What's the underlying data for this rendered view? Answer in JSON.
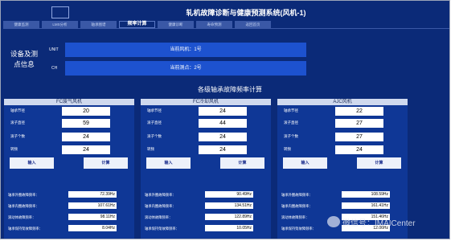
{
  "header": {
    "title": "轧机故障诊断与健康预测系统(风机-1)"
  },
  "tabs": [
    {
      "label": "健康监测"
    },
    {
      "label": "LMS分析"
    },
    {
      "label": "轴承图谱"
    },
    {
      "label": "频率计算"
    },
    {
      "label": "健康诊断"
    },
    {
      "label": "寿命预测"
    },
    {
      "label": "返回首页"
    }
  ],
  "equipment_info": {
    "label": "设备及测点信息",
    "unit_label": "UNIT",
    "unit_value": "当前风机：1号",
    "ch_label": "CH",
    "ch_value": "当前测点：2号"
  },
  "calc_title": "各级轴承故障频率计算",
  "panels": [
    {
      "title": "FC废气风机",
      "fields": [
        {
          "label": "轴承节径",
          "value": "20"
        },
        {
          "label": "滚子直径",
          "value": "59"
        },
        {
          "label": "滚子个数",
          "value": "24"
        },
        {
          "label": "转频",
          "value": "24"
        }
      ],
      "input_label": "输入",
      "calc_label": "计算",
      "results": [
        {
          "label": "轴承外圈故障频率：",
          "value": "72.39Hz"
        },
        {
          "label": "轴承内圈故障频率：",
          "value": "107.61Hz"
        },
        {
          "label": "滚动体故障频率：",
          "value": "98.11Hz"
        },
        {
          "label": "轴承保持架故障频率：",
          "value": "8.04Hz"
        }
      ]
    },
    {
      "title": "FC冷却风机",
      "fields": [
        {
          "label": "轴承节径",
          "value": "24"
        },
        {
          "label": "滚子直径",
          "value": "44"
        },
        {
          "label": "滚子个数",
          "value": "24"
        },
        {
          "label": "转频",
          "value": "24"
        }
      ],
      "input_label": "输入",
      "calc_label": "计算",
      "results": [
        {
          "label": "轴承外圈故障频率：",
          "value": "90.49Hz"
        },
        {
          "label": "轴承内圈故障频率：",
          "value": "134.51Hz"
        },
        {
          "label": "滚动体故障频率：",
          "value": "122.89Hz"
        },
        {
          "label": "轴承保持架故障频率：",
          "value": "10.05Hz"
        }
      ]
    },
    {
      "title": "AJC风机",
      "fields": [
        {
          "label": "轴承节径",
          "value": "22"
        },
        {
          "label": "滚子直径",
          "value": "27"
        },
        {
          "label": "滚子个数",
          "value": "27"
        },
        {
          "label": "转频",
          "value": "24"
        }
      ],
      "input_label": "输入",
      "calc_label": "计算",
      "results": [
        {
          "label": "轴承外圈故障频率：",
          "value": "108.59Hz"
        },
        {
          "label": "轴承内圈故障频率：",
          "value": "161.41Hz"
        },
        {
          "label": "滚动体故障频率：",
          "value": "151.46Hz"
        },
        {
          "label": "轴承保持架故障频率：",
          "value": "12.06Hz"
        }
      ]
    }
  ],
  "watermark": {
    "text": "微信号：IMAICenter"
  }
}
